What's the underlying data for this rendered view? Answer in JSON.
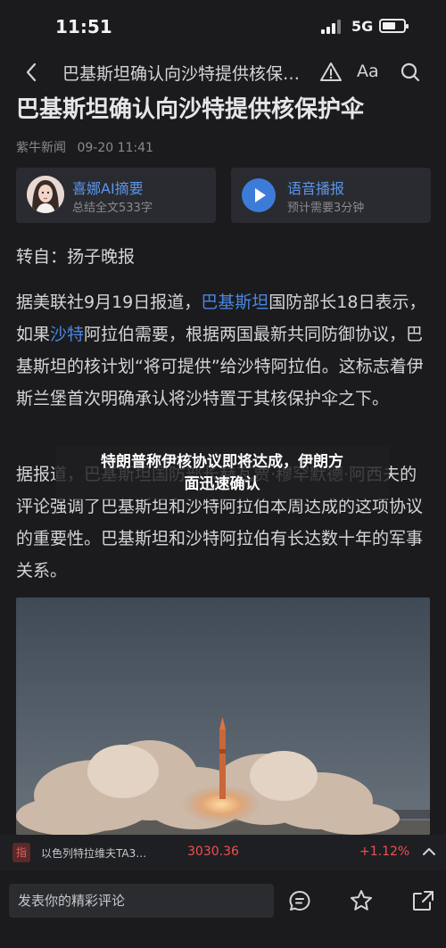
{
  "status": {
    "time": "11:51",
    "network": "5G"
  },
  "nav": {
    "title": "巴基斯坦确认向沙特提供核保…",
    "font_label": "Aa"
  },
  "article": {
    "title": "巴基斯坦确认向沙特提供核保护伞",
    "source_name": "紫牛新闻",
    "datetime": "09-20 11:41",
    "ai_card": {
      "title": "喜娜AI摘要",
      "subtitle": "总结全文533字"
    },
    "audio_card": {
      "title": "语音播报",
      "subtitle": "预计需要3分钟"
    },
    "repost": "转自：扬子晚报",
    "p1_a": "据美联社9月19日报道，",
    "p1_link1": "巴基斯坦",
    "p1_b": "国防部长18日表示，如果",
    "p1_link2": "沙特",
    "p1_c": "阿拉伯需要，根据两国最新共同防御协议，巴基斯坦的核计划“将可提供”给沙特阿拉伯。这标志着伊斯兰堡首次明确承认将沙特置于其核保护伞之下。",
    "p2": "据报道，巴基斯坦国防部长赫瓦贾·穆罕默德·阿西夫的评论强调了巴基斯坦和沙特阿拉伯本周达成的这项协议的重要性。巴基斯坦和沙特阿拉伯有长达数十年的军事关系。"
  },
  "toast": {
    "line1": "特朗普称伊核协议即将达成，伊朗方",
    "line2": "面迅速确认"
  },
  "ticker": {
    "tag": "指",
    "name": "以色列特拉维夫TA3…",
    "price": "3030.36",
    "change": "+1.12%"
  },
  "comment": {
    "placeholder": "发表你的精彩评论"
  }
}
